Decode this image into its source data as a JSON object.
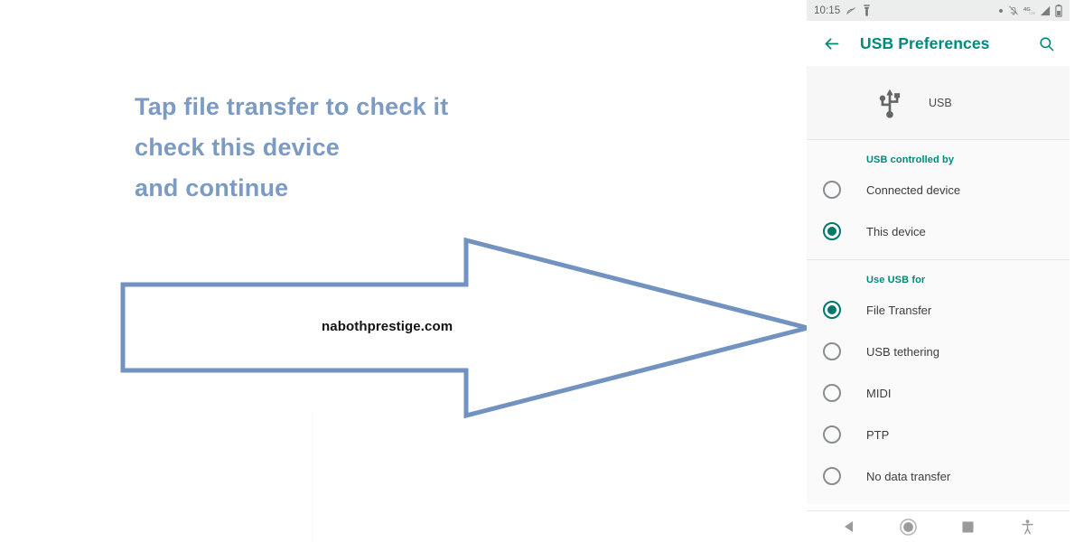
{
  "annotation": {
    "instruction_text": "Tap file transfer to check it\ncheck this device\nand continue",
    "instruction_color": "#7c9bc4",
    "arrow_color": "#7292c0",
    "watermark": "nabothprestige.com"
  },
  "phone": {
    "status_bar": {
      "clock": "10:15",
      "left_icons": [
        "dnd-slash-icon",
        "flashlight-icon"
      ],
      "right_icons": [
        "dot-icon",
        "notifications-off-icon",
        "signal-4g-icon",
        "signal-bars-icon",
        "battery-icon"
      ]
    },
    "app_bar": {
      "back_icon": "arrow-back-icon",
      "title": "USB Preferences",
      "title_color": "#00897B",
      "search_icon": "search-icon"
    },
    "hero": {
      "icon": "usb-icon",
      "label": "USB"
    },
    "sections": [
      {
        "title": "USB controlled by",
        "options": [
          {
            "label": "Connected device",
            "selected": false
          },
          {
            "label": "This device",
            "selected": true
          }
        ]
      },
      {
        "title": "Use USB for",
        "options": [
          {
            "label": "File Transfer",
            "selected": true
          },
          {
            "label": "USB tethering",
            "selected": false
          },
          {
            "label": "MIDI",
            "selected": false
          },
          {
            "label": "PTP",
            "selected": false
          },
          {
            "label": "No data transfer",
            "selected": false
          }
        ]
      }
    ],
    "nav_bar": {
      "buttons": [
        "back-triangle-icon",
        "home-circle-icon",
        "recents-square-icon",
        "accessibility-icon"
      ]
    },
    "accent_color": "#00796B"
  }
}
